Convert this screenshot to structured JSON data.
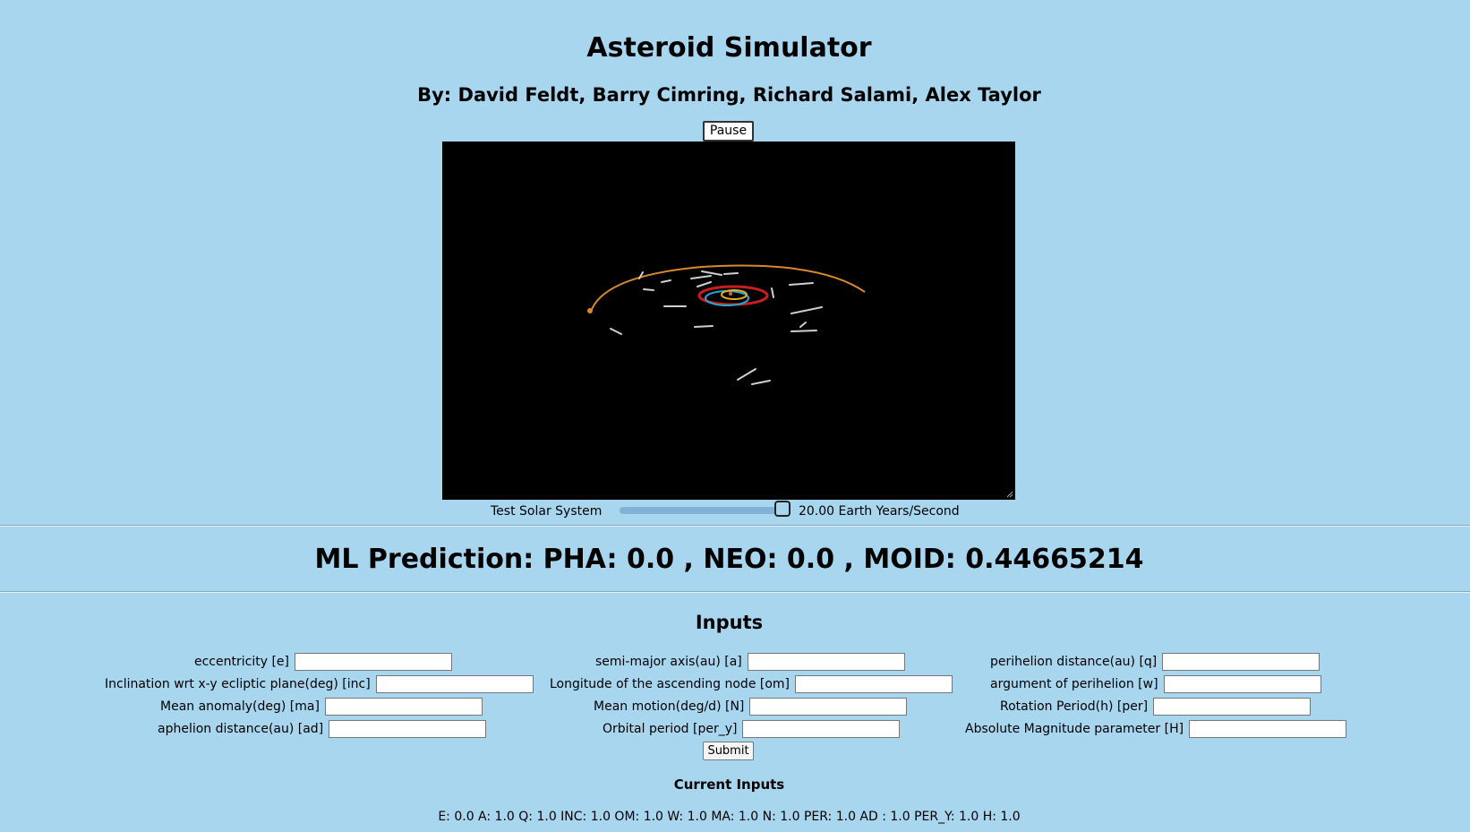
{
  "header": {
    "title": "Asteroid Simulator",
    "byline": "By: David Feldt, Barry Cimring, Richard Salami, Alex Taylor"
  },
  "controls": {
    "pause_label": "Pause",
    "system_label": "Test Solar System",
    "speed_label": "20.00 Earth Years/Second",
    "speed_slider_fraction": 1.0
  },
  "colors": {
    "background": "#a9d6ef",
    "canvas": "#000000",
    "orbit_outer": "#d9892a",
    "orbit_red": "#c81e1e",
    "orbit_blue": "#2aa6d9",
    "orbit_yellow": "#e0b020"
  },
  "prediction": {
    "text": "ML Prediction: PHA: 0.0 , NEO: 0.0 , MOID: 0.44665214"
  },
  "inputs": {
    "title": "Inputs",
    "fields": {
      "e": {
        "label": "eccentricity [e]",
        "value": ""
      },
      "a": {
        "label": "semi-major axis(au) [a]",
        "value": ""
      },
      "q": {
        "label": "perihelion distance(au) [q]",
        "value": ""
      },
      "inc": {
        "label": "Inclination wrt x-y ecliptic plane(deg) [inc]",
        "value": ""
      },
      "om": {
        "label": "Longitude of the ascending node [om]",
        "value": ""
      },
      "w": {
        "label": "argument of perihelion [w]",
        "value": ""
      },
      "ma": {
        "label": "Mean anomaly(deg) [ma]",
        "value": ""
      },
      "n": {
        "label": "Mean motion(deg/d) [N]",
        "value": ""
      },
      "per": {
        "label": "Rotation Period(h) [per]",
        "value": ""
      },
      "ad": {
        "label": "aphelion distance(au) [ad]",
        "value": ""
      },
      "per_y": {
        "label": "Orbital period [per_y]",
        "value": ""
      },
      "h": {
        "label": "Absolute Magnitude parameter [H]",
        "value": ""
      }
    },
    "submit_label": "Submit"
  },
  "current_inputs": {
    "title": "Current Inputs",
    "text": "E: 0.0 A: 1.0 Q: 1.0 INC: 1.0 OM: 1.0 W: 1.0 MA: 1.0 N: 1.0 PER: 1.0 AD : 1.0 PER_Y: 1.0 H: 1.0"
  }
}
